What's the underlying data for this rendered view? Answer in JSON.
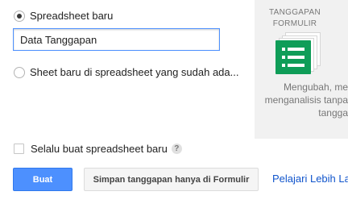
{
  "options": {
    "new_spreadsheet_label": "Spreadsheet baru",
    "new_spreadsheet_selected": true,
    "spreadsheet_name_value": "Data Tanggapan",
    "existing_spreadsheet_label": "Sheet baru di spreadsheet yang sudah ada..."
  },
  "side_panel": {
    "title_line1": "TANGGAPAN",
    "title_line2": "FORMULIR",
    "desc_line1": "Mengubah, me",
    "desc_line2": "menganalisis tanpa",
    "desc_line3": "tangga",
    "icon": "sheets-icon",
    "icon_color": "#0f9d58"
  },
  "always_new": {
    "label": "Selalu buat spreadsheet baru",
    "help_glyph": "?",
    "checked": false
  },
  "actions": {
    "create_label": "Buat",
    "keep_in_forms_label": "Simpan tanggapan hanya di Formulir",
    "learn_more_label": "Pelajari Lebih La"
  },
  "colors": {
    "primary": "#4d90fe",
    "link": "#1155cc",
    "sheets_green": "#0f9d58"
  }
}
